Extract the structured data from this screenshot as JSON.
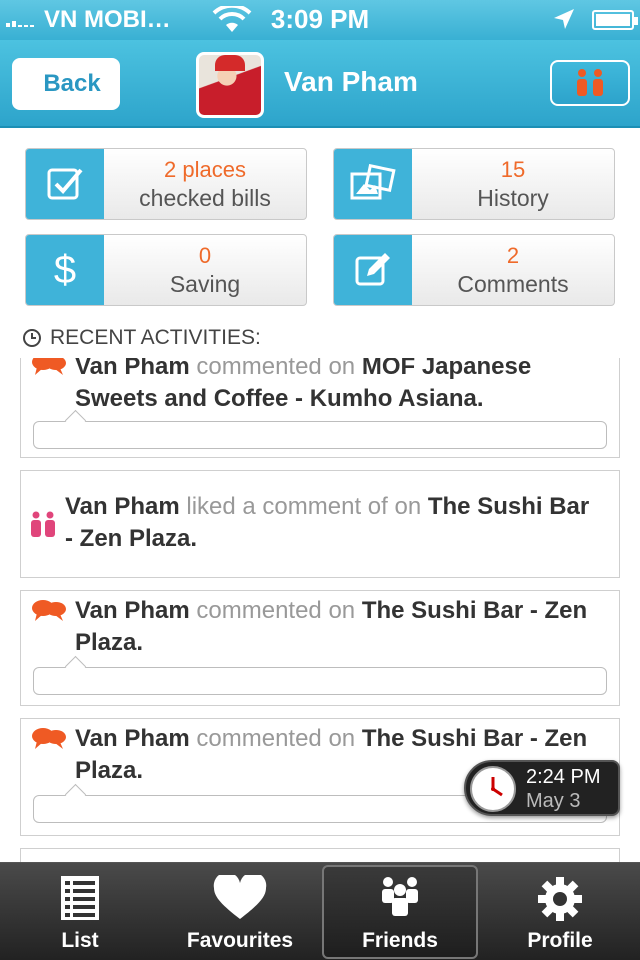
{
  "status": {
    "carrier": "VN MOBI…",
    "time": "3:09 PM"
  },
  "nav": {
    "back_label": "Back",
    "title": "Van Pham"
  },
  "stats": [
    {
      "value": "2 places",
      "label": "checked bills",
      "icon": "checkbox-icon"
    },
    {
      "value": "15",
      "label": "History",
      "icon": "pictures-icon"
    },
    {
      "value": "0",
      "label": "Saving",
      "icon": "dollar-icon"
    },
    {
      "value": "2",
      "label": "Comments",
      "icon": "edit-icon"
    }
  ],
  "recent_label": "RECENT ACTIVITIES:",
  "activities": [
    {
      "icon": "comment-icon",
      "user": "Van Pham",
      "verb": "commented on",
      "place": "MOF Japanese Sweets and Coffee - Kumho Asiana."
    },
    {
      "icon": "people-icon",
      "user": "Van Pham",
      "verb": "liked a comment of on",
      "place": "The Sushi Bar - Zen Plaza."
    },
    {
      "icon": "comment-icon",
      "user": "Van Pham",
      "verb": "commented on",
      "place": "The Sushi Bar - Zen Plaza."
    },
    {
      "icon": "comment-icon",
      "user": "Van Pham",
      "verb": "commented on",
      "place": "The Sushi Bar - Zen Plaza."
    }
  ],
  "clock": {
    "time": "2:24 PM",
    "date": "May 3"
  },
  "tabs": [
    {
      "label": "List",
      "icon": "list-icon"
    },
    {
      "label": "Favourites",
      "icon": "heart-icon"
    },
    {
      "label": "Friends",
      "icon": "friends-icon"
    },
    {
      "label": "Profile",
      "icon": "gear-icon"
    }
  ],
  "colors": {
    "accent": "#3fb3d9",
    "highlight": "#ef6a2a",
    "pink": "#e0457b"
  }
}
